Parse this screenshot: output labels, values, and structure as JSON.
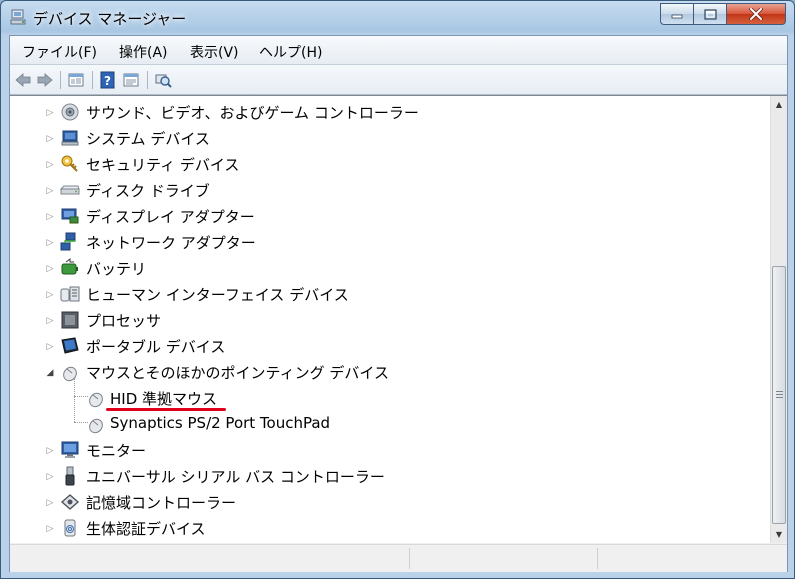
{
  "window": {
    "title": "デバイス マネージャー",
    "icon": "device-manager-icon",
    "controls": {
      "minimize": "minimize-icon",
      "maximize": "maximize-icon",
      "close": "close-icon"
    }
  },
  "menu": [
    {
      "label": "ファイル(F)"
    },
    {
      "label": "操作(A)"
    },
    {
      "label": "表示(V)"
    },
    {
      "label": "ヘルプ(H)"
    }
  ],
  "toolbar": [
    {
      "icon": "back-arrow-icon"
    },
    {
      "icon": "forward-arrow-icon"
    },
    {
      "icon": "properties-icon"
    },
    {
      "icon": "help-icon"
    },
    {
      "icon": "update-driver-icon"
    },
    {
      "icon": "scan-hardware-icon"
    }
  ],
  "tree": {
    "items": [
      {
        "label": "サウンド、ビデオ、およびゲーム コントローラー",
        "icon": "speaker-icon",
        "expanded": false
      },
      {
        "label": "システム デバイス",
        "icon": "system-device-icon",
        "expanded": false
      },
      {
        "label": "セキュリティ デバイス",
        "icon": "security-key-icon",
        "expanded": false
      },
      {
        "label": "ディスク ドライブ",
        "icon": "disk-drive-icon",
        "expanded": false
      },
      {
        "label": "ディスプレイ アダプター",
        "icon": "display-adapter-icon",
        "expanded": false
      },
      {
        "label": "ネットワーク アダプター",
        "icon": "network-adapter-icon",
        "expanded": false
      },
      {
        "label": "バッテリ",
        "icon": "battery-icon",
        "expanded": false
      },
      {
        "label": "ヒューマン インターフェイス デバイス",
        "icon": "hid-icon",
        "expanded": false
      },
      {
        "label": "プロセッサ",
        "icon": "processor-icon",
        "expanded": false
      },
      {
        "label": "ポータブル デバイス",
        "icon": "portable-device-icon",
        "expanded": false
      },
      {
        "label": "マウスとそのほかのポインティング デバイス",
        "icon": "mouse-icon",
        "expanded": true
      },
      {
        "label": "HID 準拠マウス",
        "icon": "mouse-icon",
        "child": true,
        "highlighted": true
      },
      {
        "label": "Synaptics PS/2 Port TouchPad",
        "icon": "mouse-icon",
        "child": true
      },
      {
        "label": "モニター",
        "icon": "monitor-icon",
        "expanded": false
      },
      {
        "label": "ユニバーサル シリアル バス コントローラー",
        "icon": "usb-icon",
        "expanded": false
      },
      {
        "label": "記憶域コントローラー",
        "icon": "storage-controller-icon",
        "expanded": false
      },
      {
        "label": "生体認証デバイス",
        "icon": "biometric-icon",
        "expanded": false
      }
    ]
  },
  "colors": {
    "highlight_underline": "#e0001a",
    "title_bar": "#b9d1e9",
    "close_button": "#c13516"
  }
}
